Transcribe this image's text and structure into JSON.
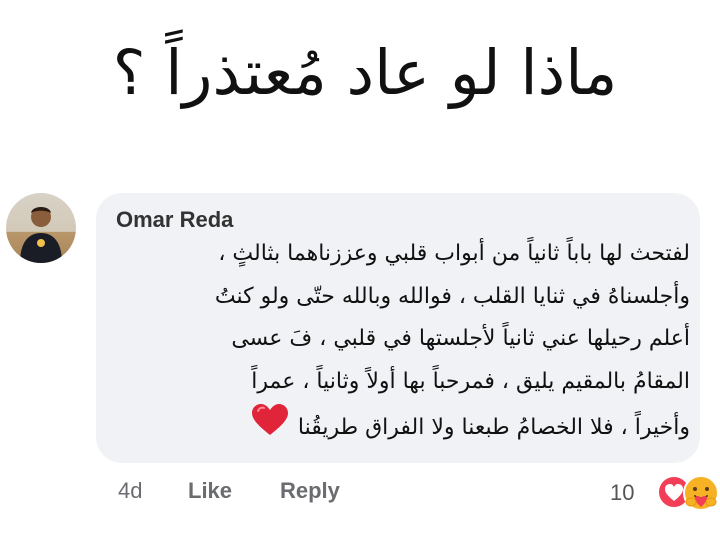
{
  "headline": "ماذا لو عاد مُعتذراً ؟",
  "comment": {
    "author": "Omar Reda",
    "lines": [
      "لفتحث لها باباً ثانياً من أبواب قلبي وعززناهما بثالثٍ ،",
      "وأجلسناهُ في ثنايا القلب ، فوالله وبالله حتّى ولو كنتُ",
      "أعلم رحيلها عني ثانياً لأجلستها في قلبي ، فَ عسى",
      "المقامُ بالمقيم يليق ، فمرحباً بها أولاً وثانياً ، عمراً",
      "وأخيراً ، فلا الخصامُ طبعنا ولا الفراق طريقُنا"
    ],
    "end_emoji": "red-heart-icon"
  },
  "actions": {
    "time": "4d",
    "like": "Like",
    "reply": "Reply"
  },
  "reactions": {
    "count": "10",
    "icons": [
      "love-reaction-icon",
      "care-reaction-icon"
    ]
  },
  "colors": {
    "bubble": "#f0f2f5",
    "heart": "#e0243a",
    "love_reaction": "#f33e58",
    "care_reaction": "#f7b125",
    "meta_text": "#6a6c70"
  }
}
